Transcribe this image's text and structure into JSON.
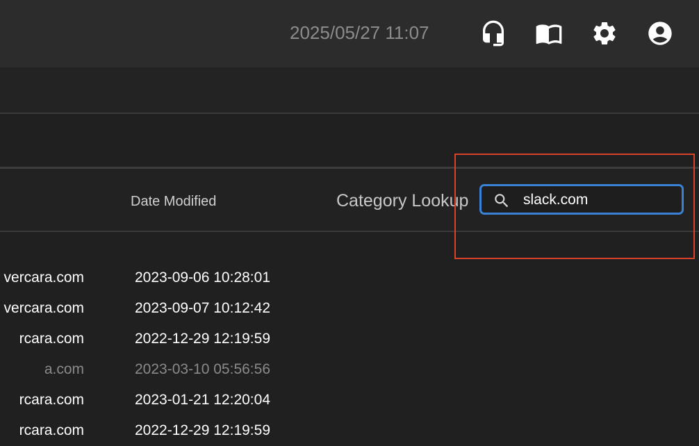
{
  "header": {
    "datetime": "2025/05/27 11:07",
    "icons": [
      "headset-icon",
      "book-icon",
      "gear-icon",
      "account-icon"
    ]
  },
  "table": {
    "columns": {
      "date_modified": "Date Modified",
      "category_lookup": "Category Lookup"
    },
    "search": {
      "value": "slack.com"
    },
    "rows": [
      {
        "domain": "vercara.com",
        "date": "2023-09-06 10:28:01",
        "dim": false
      },
      {
        "domain": "vercara.com",
        "date": "2023-09-07 10:12:42",
        "dim": false
      },
      {
        "domain": "rcara.com",
        "date": "2022-12-29 12:19:59",
        "dim": false
      },
      {
        "domain": "a.com",
        "date": "2023-03-10 05:56:56",
        "dim": true
      },
      {
        "domain": "rcara.com",
        "date": "2023-01-21 12:20:04",
        "dim": false
      },
      {
        "domain": "rcara.com",
        "date": "2022-12-29 12:19:59",
        "dim": false
      }
    ]
  },
  "colors": {
    "accent_border": "#3a82d6",
    "highlight_box": "#d9432a"
  }
}
